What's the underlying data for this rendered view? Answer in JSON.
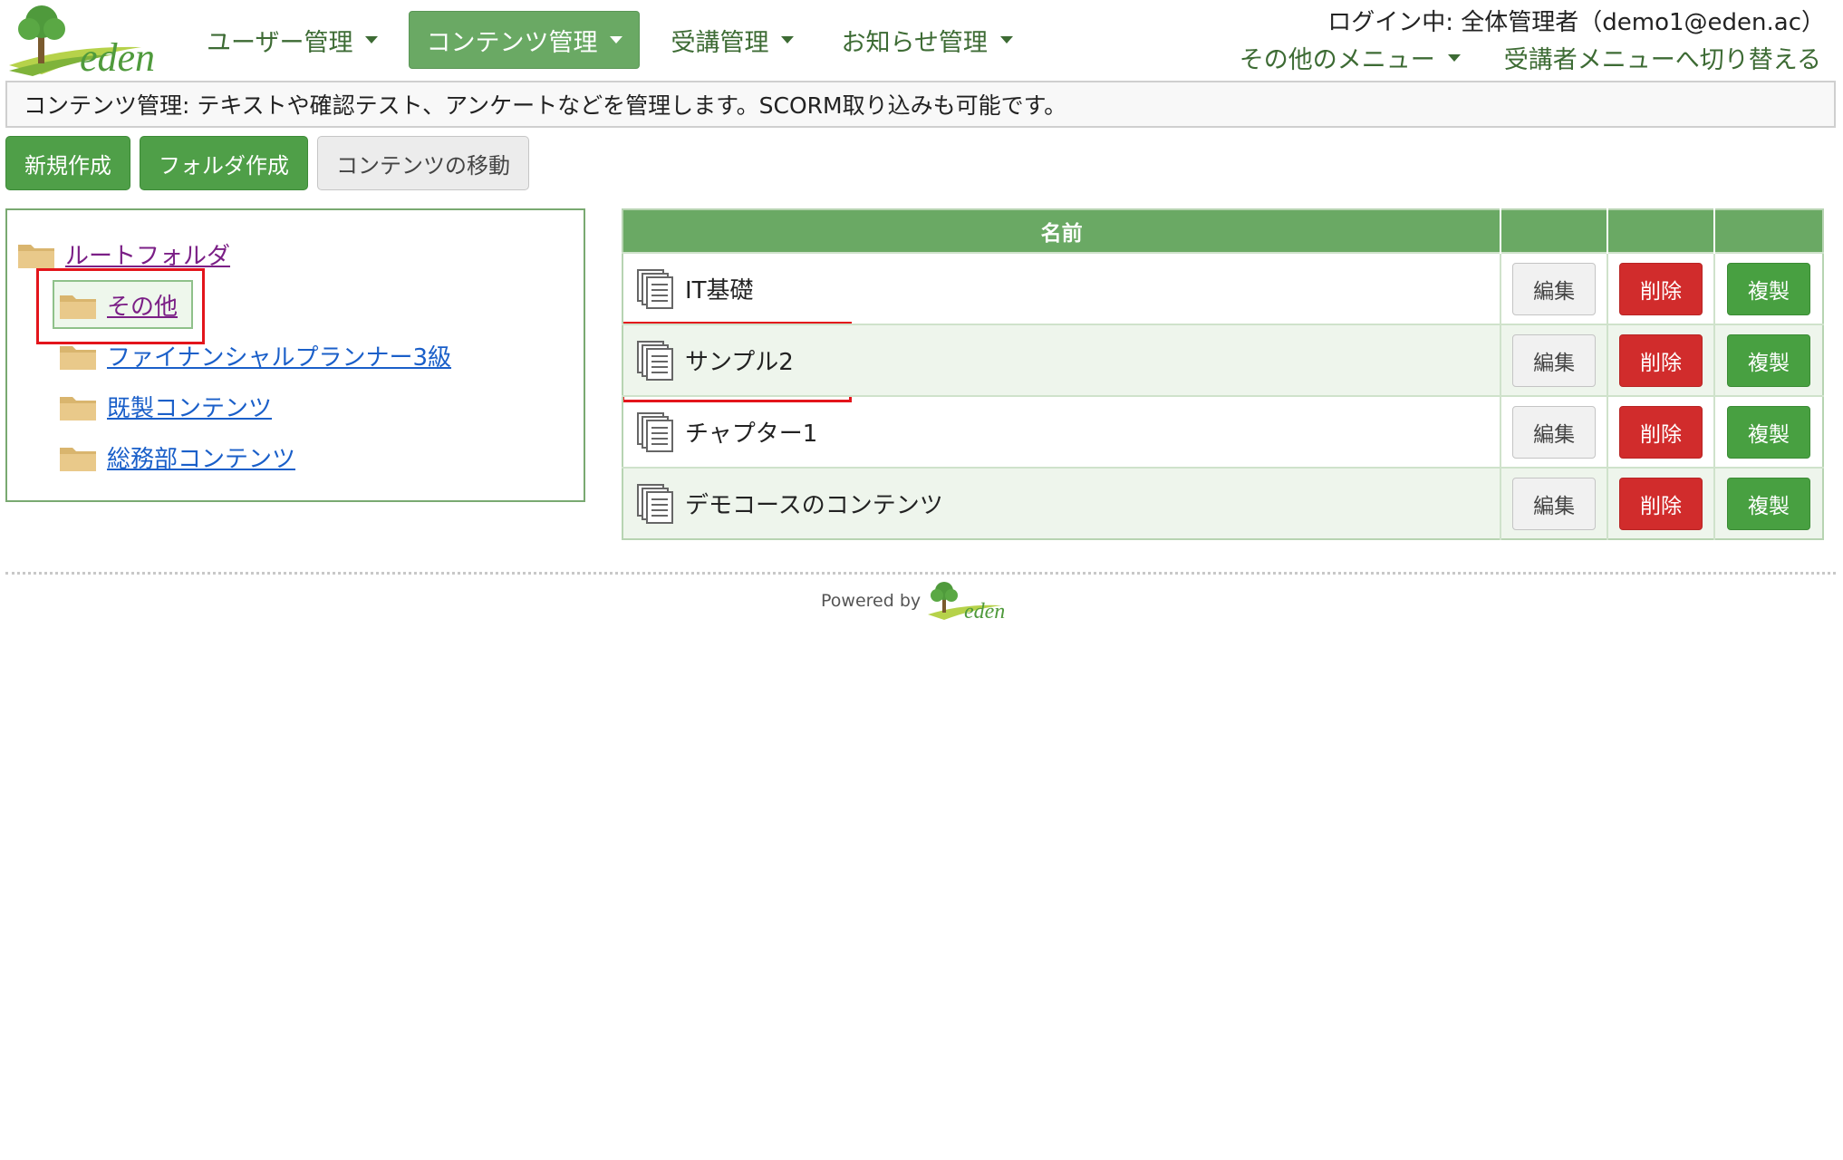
{
  "header": {
    "logo_text": "eden",
    "nav": [
      {
        "label": "ユーザー管理"
      },
      {
        "label": "コンテンツ管理"
      },
      {
        "label": "受講管理"
      },
      {
        "label": "お知らせ管理"
      }
    ],
    "active_nav": "コンテンツ管理",
    "login_text": "ログイン中: 全体管理者（demo1@eden.ac）",
    "other_menu_label": "その他のメニュー",
    "switch_label": "受講者メニューへ切り替える"
  },
  "info_bar": {
    "text": "コンテンツ管理: テキストや確認テスト、アンケートなどを管理します。SCORM取り込みも可能です。"
  },
  "toolbar": {
    "new_label": "新規作成",
    "new_folder_label": "フォルダ作成",
    "move_label": "コンテンツの移動"
  },
  "tree": {
    "root": "ルートフォルダ",
    "folders": [
      {
        "label": "その他"
      },
      {
        "label": "ファイナンシャルプランナー3級"
      },
      {
        "label": "既製コンテンツ"
      },
      {
        "label": "総務部コンテンツ"
      }
    ],
    "selected": "その他"
  },
  "table": {
    "header_name": "名前",
    "rows": [
      {
        "name": "IT基礎"
      },
      {
        "name": "サンプル2"
      },
      {
        "name": "チャプター1"
      },
      {
        "name": "デモコースのコンテンツ"
      }
    ],
    "edit_label": "編集",
    "delete_label": "削除",
    "copy_label": "複製"
  },
  "footer": {
    "powered_by": "Powered by",
    "logo_text": "eden"
  },
  "colors": {
    "brand_green": "#6aa964",
    "button_green": "#4f9f48",
    "delete_red": "#d12c2c",
    "highlight_red": "#e3151b"
  }
}
